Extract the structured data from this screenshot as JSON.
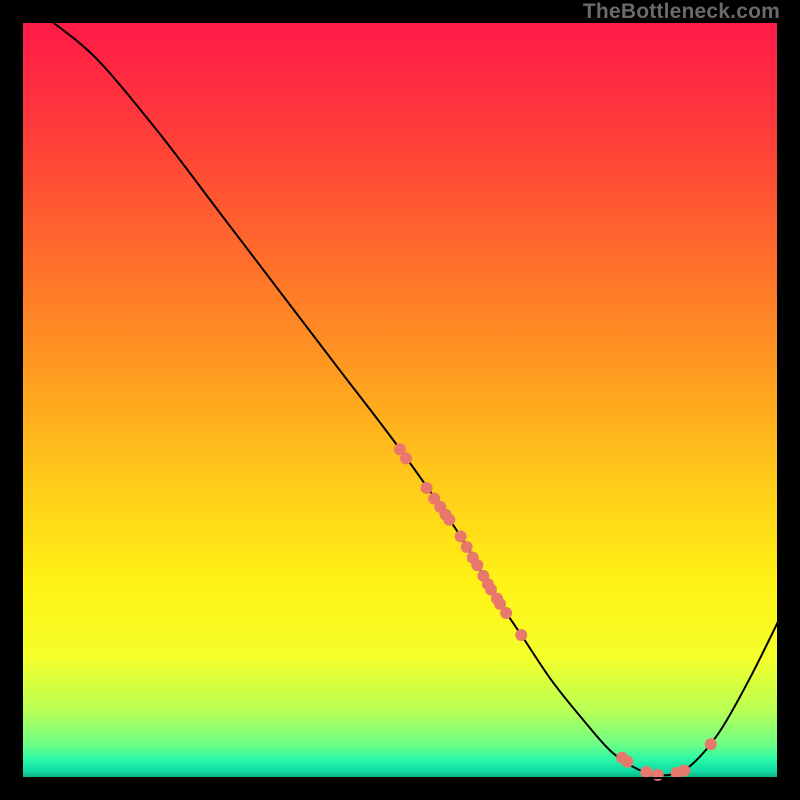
{
  "watermark": "TheBottleneck.com",
  "colors": {
    "dot": "#e9786c",
    "curve": "#000000",
    "frame": "#000000",
    "background_black": "#000000"
  },
  "chart_data": {
    "type": "line",
    "title": "",
    "xlabel": "",
    "ylabel": "",
    "xlim": [
      0,
      100
    ],
    "ylim": [
      0,
      100
    ],
    "x": [
      4,
      10,
      18,
      26,
      34,
      42,
      50,
      58,
      62,
      66,
      70,
      74,
      78,
      82,
      85,
      88,
      92,
      96,
      100
    ],
    "values": [
      100,
      95,
      85.5,
      75,
      64.5,
      54,
      43.5,
      32,
      25,
      19,
      13,
      8,
      3.5,
      1,
      0.5,
      1.5,
      6,
      13,
      21
    ],
    "gradient_stops": [
      {
        "offset": 0.0,
        "color": "#ff1a48"
      },
      {
        "offset": 0.14,
        "color": "#ff3a3a"
      },
      {
        "offset": 0.3,
        "color": "#ff6a2c"
      },
      {
        "offset": 0.46,
        "color": "#ff9a20"
      },
      {
        "offset": 0.6,
        "color": "#ffc81a"
      },
      {
        "offset": 0.74,
        "color": "#fff215"
      },
      {
        "offset": 0.84,
        "color": "#f4ff2a"
      },
      {
        "offset": 0.91,
        "color": "#b8ff55"
      },
      {
        "offset": 0.955,
        "color": "#6cff88"
      },
      {
        "offset": 0.975,
        "color": "#28f7a6"
      },
      {
        "offset": 0.99,
        "color": "#0fd9a4"
      },
      {
        "offset": 1.0,
        "color": "#0aa673"
      }
    ],
    "scatter_points": [
      {
        "x": 50.0,
        "y": 43.5
      },
      {
        "x": 50.8,
        "y": 42.3
      },
      {
        "x": 53.5,
        "y": 38.4
      },
      {
        "x": 54.5,
        "y": 37.0
      },
      {
        "x": 55.3,
        "y": 35.9
      },
      {
        "x": 56.0,
        "y": 34.9
      },
      {
        "x": 56.5,
        "y": 34.2
      },
      {
        "x": 58.0,
        "y": 32.0
      },
      {
        "x": 58.8,
        "y": 30.6
      },
      {
        "x": 59.6,
        "y": 29.2
      },
      {
        "x": 60.2,
        "y": 28.2
      },
      {
        "x": 61.0,
        "y": 26.8
      },
      {
        "x": 61.6,
        "y": 25.7
      },
      {
        "x": 62.0,
        "y": 25.0
      },
      {
        "x": 62.8,
        "y": 23.8
      },
      {
        "x": 63.2,
        "y": 23.1
      },
      {
        "x": 64.0,
        "y": 21.9
      },
      {
        "x": 66.0,
        "y": 19.0
      },
      {
        "x": 79.3,
        "y": 2.8
      },
      {
        "x": 80.0,
        "y": 2.3
      },
      {
        "x": 82.5,
        "y": 0.9
      },
      {
        "x": 84.0,
        "y": 0.55
      },
      {
        "x": 86.5,
        "y": 0.8
      },
      {
        "x": 87.5,
        "y": 1.1
      },
      {
        "x": 91.0,
        "y": 4.6
      }
    ],
    "dot_radius_px": 6.0
  }
}
